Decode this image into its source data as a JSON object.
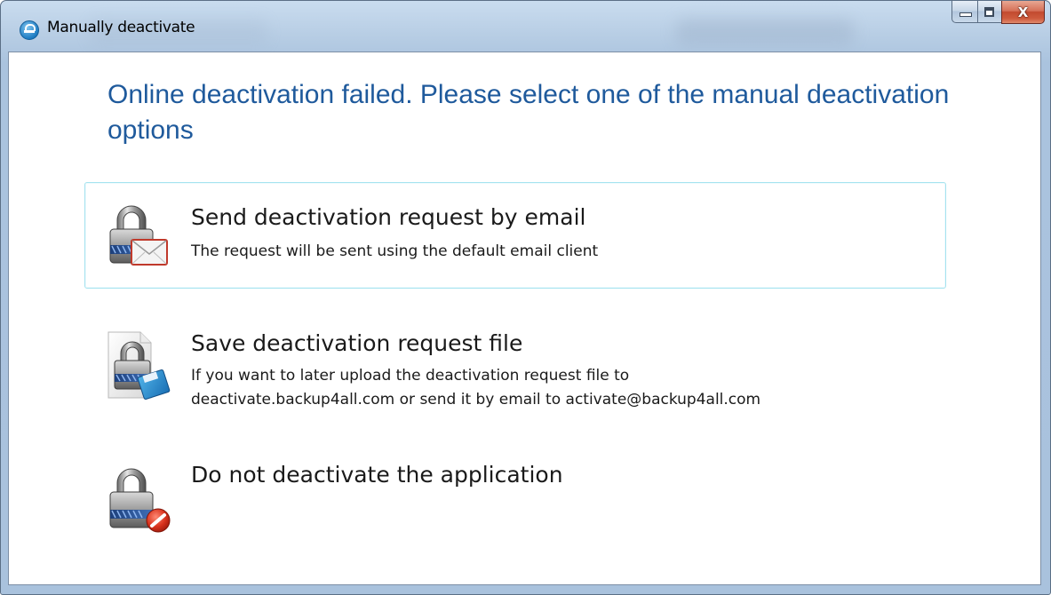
{
  "window": {
    "title": "Manually deactivate",
    "close_glyph": "X"
  },
  "heading": "Online deactivation failed. Please select one of the manual deactivation options",
  "options": [
    {
      "title": "Send deactivation request by email",
      "description": "The request will be sent using the default email client",
      "icon": "lock-email-icon",
      "selected": true
    },
    {
      "title": "Save deactivation request file",
      "description_line1": "If you want to later upload the deactivation request file to",
      "description_line2": "deactivate.backup4all.com or send it by email to activate@backup4all.com",
      "icon": "lock-save-file-icon",
      "selected": false
    },
    {
      "title": "Do not deactivate the application",
      "icon": "lock-cancel-icon",
      "selected": false
    }
  ],
  "colors": {
    "heading": "#1f5a9c",
    "selected_border": "#a6e3ef",
    "close_button": "#c24a2f",
    "frame": "#b7cde4"
  }
}
